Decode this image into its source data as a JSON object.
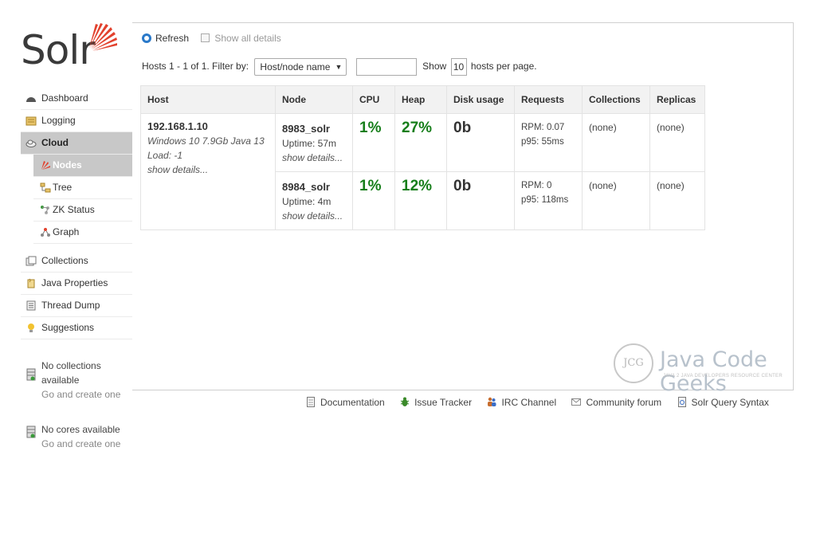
{
  "logo": {
    "text": "Solr"
  },
  "sidebar": {
    "items": [
      {
        "label": "Dashboard",
        "icon": "dashboard-icon"
      },
      {
        "label": "Logging",
        "icon": "logging-icon"
      },
      {
        "label": "Cloud",
        "icon": "cloud-icon"
      },
      {
        "label": "Collections",
        "icon": "collections-icon"
      },
      {
        "label": "Java Properties",
        "icon": "java-properties-icon"
      },
      {
        "label": "Thread Dump",
        "icon": "thread-dump-icon"
      },
      {
        "label": "Suggestions",
        "icon": "lightbulb-icon"
      }
    ],
    "cloud_sub": [
      {
        "label": "Nodes",
        "icon": "nodes-icon"
      },
      {
        "label": "Tree",
        "icon": "tree-icon"
      },
      {
        "label": "ZK Status",
        "icon": "zk-status-icon"
      },
      {
        "label": "Graph",
        "icon": "graph-icon"
      }
    ],
    "no_collections": {
      "text": "No collections available",
      "link": "Go and create one"
    },
    "no_cores": {
      "text": "No cores available",
      "link": "Go and create one"
    }
  },
  "toolbar": {
    "refresh": "Refresh",
    "show_all": "Show all details"
  },
  "filter": {
    "hosts_text": "Hosts 1 - 1 of 1.",
    "filter_by": "Filter by:",
    "select_value": "Host/node name",
    "show": "Show",
    "per_page_value": "10",
    "per_page_suffix": "hosts per page."
  },
  "table": {
    "headers": [
      "Host",
      "Node",
      "CPU",
      "Heap",
      "Disk usage",
      "Requests",
      "Collections",
      "Replicas"
    ],
    "host": {
      "name": "192.168.1.10",
      "os": "Windows 10 7.9Gb Java 13",
      "load": "Load: -1",
      "details": "show details..."
    },
    "rows": [
      {
        "node": "8983_solr",
        "uptime": "Uptime: 57m",
        "details": "show details...",
        "cpu": "1%",
        "heap": "27%",
        "disk": "0b",
        "rpm": "RPM: 0.07",
        "p95": "p95: 55ms",
        "collections": "(none)",
        "replicas": "(none)"
      },
      {
        "node": "8984_solr",
        "uptime": "Uptime: 4m",
        "details": "show details...",
        "cpu": "1%",
        "heap": "12%",
        "disk": "0b",
        "rpm": "RPM: 0",
        "p95": "p95: 118ms",
        "collections": "(none)",
        "replicas": "(none)"
      }
    ]
  },
  "watermark": {
    "title": "Java Code Geeks",
    "sub": "JAVA 2 JAVA DEVELOPERS RESOURCE CENTER",
    "badge": "JCG"
  },
  "footer": [
    {
      "label": "Documentation",
      "icon": "document-icon"
    },
    {
      "label": "Issue Tracker",
      "icon": "bug-icon"
    },
    {
      "label": "IRC Channel",
      "icon": "people-icon"
    },
    {
      "label": "Community forum",
      "icon": "mail-icon"
    },
    {
      "label": "Solr Query Syntax",
      "icon": "query-syntax-icon"
    }
  ],
  "colors": {
    "accent_green": "#167e1a",
    "active_nav": "#c8c8c8",
    "refresh_blue": "#2a79c9",
    "logo_red": "#e2412d"
  }
}
